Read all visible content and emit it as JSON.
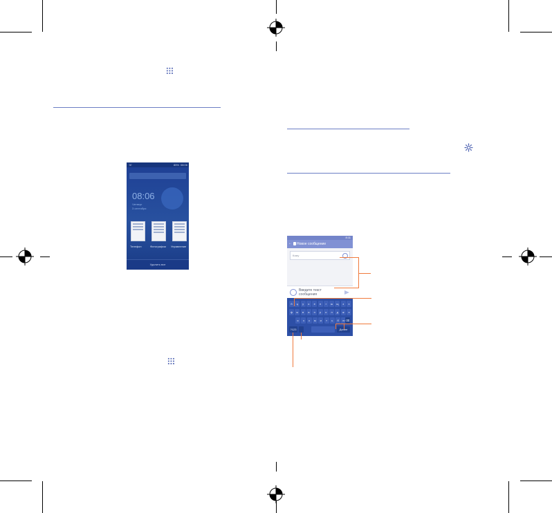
{
  "icons": {
    "apps_icon": "apps-grid-icon",
    "settings_icon": "gear-icon",
    "registration_mark": "registration-mark-icon"
  },
  "colors": {
    "accent_rule": "#6a7ec4",
    "callout": "#f07a3c",
    "phone_home_bg": "#1e3f94",
    "keyboard_bg": "#2d4fa6"
  },
  "recent_apps_screen": {
    "status_time": "08:06",
    "status_battery": "85%",
    "clock": "08:06",
    "date_line1": "Четверг",
    "date_line2": "3 сентября",
    "cards": [
      {
        "label": "Телефон"
      },
      {
        "label": "Фотографии"
      },
      {
        "label": "Управление"
      }
    ],
    "bottom_button": "Удалить все"
  },
  "messaging_screen": {
    "status_time": "8:11",
    "title": "Новое сообщение",
    "to_placeholder": "Кому",
    "compose_line1": "Введите текст",
    "compose_line2": "сообщения",
    "keyboard_rows": [
      [
        "й",
        "ц",
        "у",
        "к",
        "е",
        "н",
        "г",
        "ш",
        "щ",
        "з",
        "х"
      ],
      [
        "ф",
        "ы",
        "в",
        "а",
        "п",
        "р",
        "о",
        "л",
        "д",
        "ж",
        "э"
      ],
      [
        "я",
        "ч",
        "с",
        "м",
        "и",
        "т",
        "ь",
        "б",
        "ю"
      ]
    ],
    "key_symbols": "?123",
    "key_done": "Далее"
  }
}
